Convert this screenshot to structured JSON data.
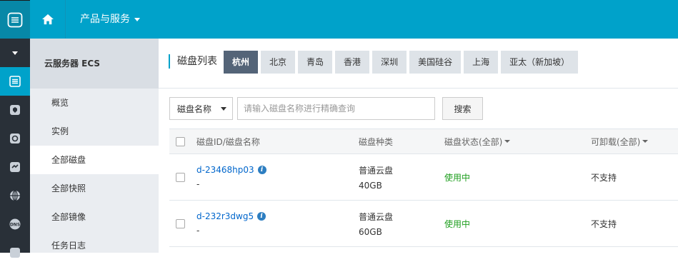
{
  "topbar": {
    "product_menu_label": "产品与服务"
  },
  "sidebar": {
    "title": "云服务器 ECS",
    "items": [
      {
        "label": "概览"
      },
      {
        "label": "实例"
      },
      {
        "label": "全部磁盘"
      },
      {
        "label": "全部快照"
      },
      {
        "label": "全部镜像"
      },
      {
        "label": "任务日志"
      }
    ],
    "active_index": 2
  },
  "iconbar": {
    "icons": [
      "logo-icon",
      "collapse-caret-icon",
      "server-icon",
      "shield-icon",
      "safe-icon",
      "monitor-icon",
      "globe-icon",
      "dns-icon",
      "more-icon"
    ]
  },
  "main": {
    "section_title": "磁盘列表",
    "regions": [
      "杭州",
      "北京",
      "青岛",
      "香港",
      "深圳",
      "美国硅谷",
      "上海",
      "亚太（新加坡）"
    ],
    "active_region": "杭州",
    "search": {
      "select_value": "磁盘名称",
      "placeholder": "请输入磁盘名称进行精确查询",
      "button_label": "搜索"
    },
    "table": {
      "headers": {
        "id": "磁盘ID/磁盘名称",
        "type": "磁盘种类",
        "status": "磁盘状态(全部)",
        "detach": "可卸载(全部)"
      },
      "rows": [
        {
          "id": "d-23468hp03",
          "name": "-",
          "type": "普通云盘",
          "size": "40GB",
          "status": "使用中",
          "detach": "不支持"
        },
        {
          "id": "d-232r3dwg5",
          "name": "-",
          "type": "普通云盘",
          "size": "60GB",
          "status": "使用中",
          "detach": "不支持"
        }
      ]
    }
  },
  "colors": {
    "accent": "#00a2ca",
    "sidebar_bg": "#eaedf1",
    "iconbar_bg": "#293038",
    "active_tab": "#546478",
    "status_ok": "#1e9e1e",
    "link": "#0066cc"
  }
}
